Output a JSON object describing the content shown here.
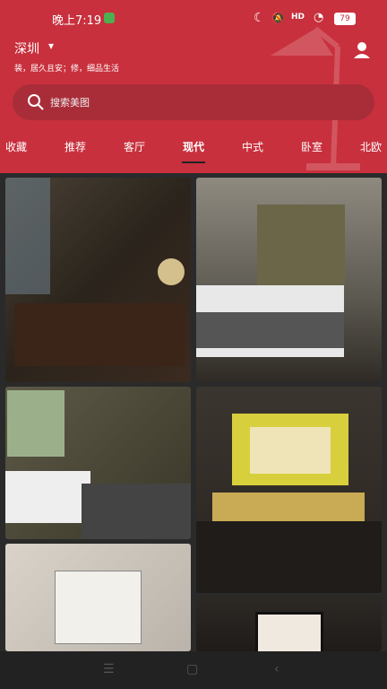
{
  "status_bar": {
    "time": "晚上7:19",
    "hd": "HD",
    "battery": "79"
  },
  "header": {
    "city": "深圳",
    "slogan": "装，居久且安；修，细品生活"
  },
  "search": {
    "placeholder": "搜索美图"
  },
  "tabs": [
    "收藏",
    "推荐",
    "客厅",
    "现代",
    "中式",
    "卧室",
    "北欧"
  ],
  "active_tab": "现代",
  "colors": {
    "brand": "#c8303d",
    "search_bg": "#a92d39",
    "page_bg": "#2a2a2a"
  },
  "icons": [
    "moon-icon",
    "mute-icon",
    "wifi-icon",
    "battery-icon",
    "chevron-down-icon",
    "user-icon",
    "search-icon",
    "menu-icon",
    "home-icon",
    "back-icon"
  ]
}
